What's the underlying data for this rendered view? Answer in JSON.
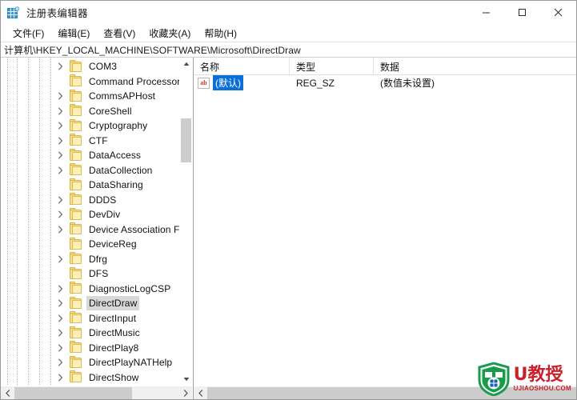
{
  "window": {
    "title": "注册表编辑器",
    "icon": "registry-editor-icon",
    "minimize_label": "—",
    "maximize_label": "□",
    "close_label": "✕"
  },
  "menubar": {
    "items": [
      {
        "label": "文件(F)"
      },
      {
        "label": "编辑(E)"
      },
      {
        "label": "查看(V)"
      },
      {
        "label": "收藏夹(A)"
      },
      {
        "label": "帮助(H)"
      }
    ]
  },
  "address": {
    "path": "计算机\\HKEY_LOCAL_MACHINE\\SOFTWARE\\Microsoft\\DirectDraw"
  },
  "tree": {
    "items": [
      {
        "label": "COM3",
        "expandable": true,
        "selected": false
      },
      {
        "label": "Command Processor",
        "expandable": false,
        "selected": false
      },
      {
        "label": "CommsAPHost",
        "expandable": true,
        "selected": false
      },
      {
        "label": "CoreShell",
        "expandable": true,
        "selected": false
      },
      {
        "label": "Cryptography",
        "expandable": true,
        "selected": false
      },
      {
        "label": "CTF",
        "expandable": true,
        "selected": false
      },
      {
        "label": "DataAccess",
        "expandable": true,
        "selected": false
      },
      {
        "label": "DataCollection",
        "expandable": true,
        "selected": false
      },
      {
        "label": "DataSharing",
        "expandable": false,
        "selected": false
      },
      {
        "label": "DDDS",
        "expandable": true,
        "selected": false
      },
      {
        "label": "DevDiv",
        "expandable": true,
        "selected": false
      },
      {
        "label": "Device Association Fra",
        "expandable": true,
        "selected": false
      },
      {
        "label": "DeviceReg",
        "expandable": false,
        "selected": false
      },
      {
        "label": "Dfrg",
        "expandable": true,
        "selected": false
      },
      {
        "label": "DFS",
        "expandable": false,
        "selected": false
      },
      {
        "label": "DiagnosticLogCSP",
        "expandable": true,
        "selected": false
      },
      {
        "label": "DirectDraw",
        "expandable": true,
        "selected": true
      },
      {
        "label": "DirectInput",
        "expandable": true,
        "selected": false
      },
      {
        "label": "DirectMusic",
        "expandable": true,
        "selected": false
      },
      {
        "label": "DirectPlay8",
        "expandable": true,
        "selected": false
      },
      {
        "label": "DirectPlayNATHelp",
        "expandable": true,
        "selected": false
      },
      {
        "label": "DirectShow",
        "expandable": true,
        "selected": false
      }
    ]
  },
  "values": {
    "columns": [
      "名称",
      "类型",
      "数据"
    ],
    "rows": [
      {
        "name": "(默认)",
        "type": "REG_SZ",
        "data": "(数值未设置)",
        "icon": "string-value-icon",
        "selected": true
      }
    ]
  },
  "watermark": {
    "main": "U教授",
    "sub": "UJIAOSHOU.COM"
  },
  "colors": {
    "selection_blue": "#0a6fd8",
    "folder_yellow": "#fbdf8a",
    "tree_selection_gray": "#d8d8d8",
    "watermark_red": "#c8232c",
    "watermark_green": "#1a9b4a"
  }
}
